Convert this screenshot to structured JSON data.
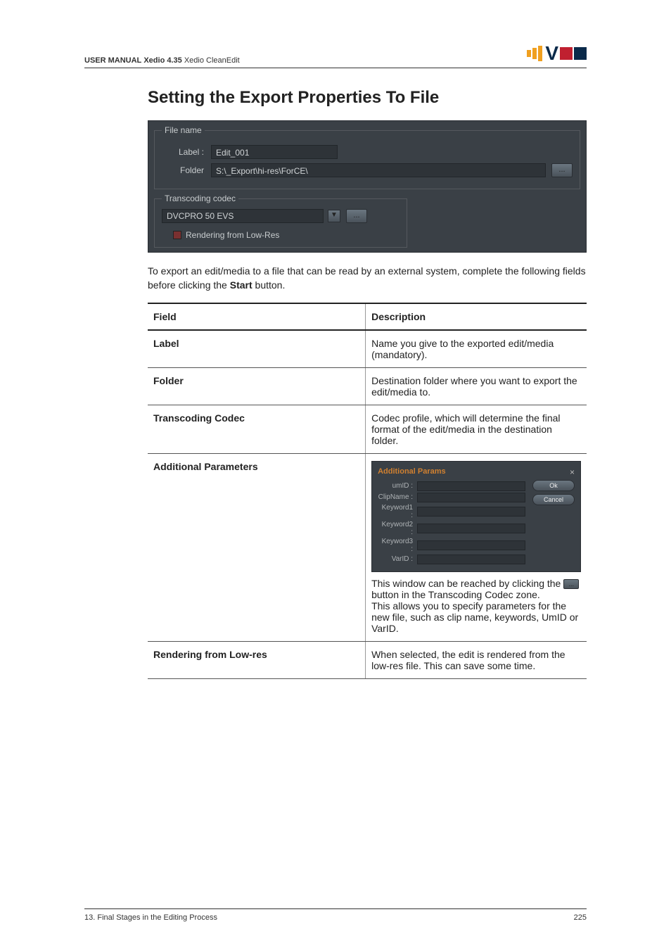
{
  "header": {
    "manual_prefix": "USER MANUAL",
    "product": "Xedio 4.35",
    "module": "Xedio CleanEdit",
    "logo_text": "V"
  },
  "section_title": "Setting the Export Properties To File",
  "ui": {
    "filename_legend": "File name",
    "label_label": "Label :",
    "label_value": "Edit_001",
    "folder_label": "Folder",
    "folder_value": "S:\\_Export\\hi-res\\ForCE\\",
    "ellipsis": "...",
    "codec_legend": "Transcoding codec",
    "codec_value": "DVCPRO 50 EVS",
    "render_lowres_label": "Rendering from Low-Res"
  },
  "intro_pre": "To export an edit/media to a file that can be read by an external system, complete the following fields before clicking the ",
  "intro_bold": "Start",
  "intro_post": " button.",
  "table": {
    "head_field": "Field",
    "head_desc": "Description",
    "rows": {
      "label": {
        "name": "Label",
        "desc": "Name you give to the exported edit/media (mandatory)."
      },
      "folder": {
        "name": "Folder",
        "desc": "Destination folder where you want to export the edit/media to."
      },
      "codec": {
        "name": "Transcoding Codec",
        "desc": "Codec profile, which will determine the final format of the edit/media in the destination folder."
      },
      "params": {
        "name": "Additional Parameters",
        "panel": {
          "title": "Additional Params",
          "close": "×",
          "umid": "umID :",
          "clipname": "ClipName :",
          "kw1": "Keyword1 :",
          "kw2": "Keyword2 :",
          "kw3": "Keyword3 :",
          "varid": "VarID :",
          "ok": "Ok",
          "cancel": "Cancel"
        },
        "desc_pre": "This window can be reached by clicking the ",
        "desc_mid": " button in the Transcoding Codec zone.",
        "desc_post": "This allows you to specify parameters for the new file, such as clip name, keywords, UmID or VarID.",
        "inline_btn": "..."
      },
      "lowres": {
        "name": "Rendering from Low-res",
        "desc": "When selected, the edit is rendered from the low-res file. This can save some time."
      }
    }
  },
  "footer": {
    "left": "13. Final Stages in the Editing Process",
    "right": "225"
  }
}
